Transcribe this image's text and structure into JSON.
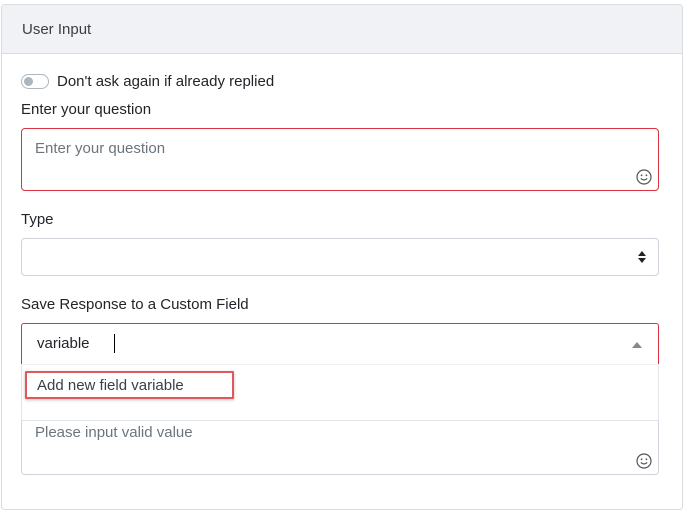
{
  "header": {
    "title": "User Input"
  },
  "toggle": {
    "label": "Don't ask again if already replied",
    "checked": false
  },
  "question": {
    "label": "Enter your question",
    "placeholder": "Enter your question"
  },
  "type": {
    "label": "Type",
    "selected": ""
  },
  "custom_field": {
    "label": "Save Response to a Custom Field",
    "value": "variable"
  },
  "dropdown": {
    "items": [
      {
        "label": "Add new field variable"
      }
    ]
  },
  "validation": {
    "placeholder": "Please input valid value"
  },
  "colors": {
    "error_border": "#d9333f",
    "highlight": "#e0575c",
    "header_bg": "#f0f2f5"
  },
  "icons": {
    "emoji": "smiley-icon",
    "select": "sort-arrows-icon",
    "combo": "triangle-up-icon"
  }
}
